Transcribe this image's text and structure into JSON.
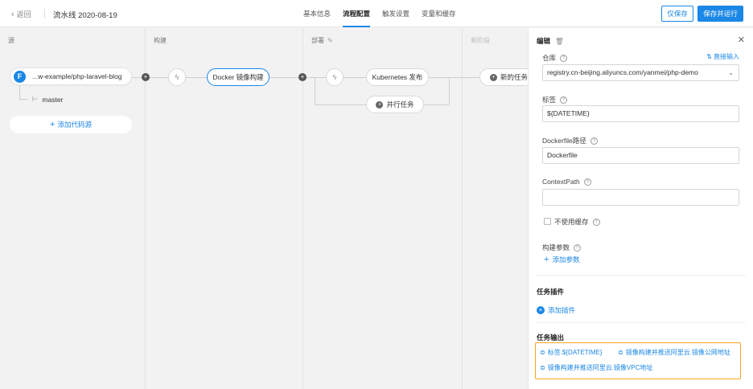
{
  "topbar": {
    "back_label": "返回",
    "pipeline_title": "流水线 2020-08-19",
    "tabs": [
      "基本信息",
      "流程配置",
      "触发设置",
      "变量和缓存"
    ],
    "save_only": "仅保存",
    "save_and_run": "保存并运行"
  },
  "stages": {
    "source_label": "源",
    "build_label": "构建",
    "deploy_label": "部署",
    "new_stage_label": "新阶段"
  },
  "source": {
    "repo": "...w-example/php-laravel-blog",
    "branch": "master",
    "add_source": "添加代码源"
  },
  "tasks": {
    "docker": "Docker 镜像构建",
    "k8s": "Kubernetes 发布",
    "parallel": "并行任务",
    "new_task": "新的任务"
  },
  "panel": {
    "title": "编辑",
    "repo_label": "仓库",
    "direct_input": "直接输入",
    "repo_value": "registry.cn-beijing.aliyuncs.com/yanmei/php-demo",
    "tag_label": "标签",
    "tag_value": "${DATETIME}",
    "dockerfile_label": "Dockerfile路径",
    "dockerfile_value": "Dockerfile",
    "context_label": "ContextPath",
    "context_value": "",
    "no_cache_label": "不使用缓存",
    "build_args_label": "构建参数",
    "add_args": "添加参数",
    "plugins_title": "任务插件",
    "add_plugin": "添加插件",
    "outputs_title": "任务输出",
    "outputs": [
      "标签.${DATETIME}",
      "镜像构建并推送阿里云.镜像公网地址",
      "镜像构建并推送阿里云.镜像VPC地址"
    ]
  },
  "colors": {
    "accent": "#1b87e6",
    "highlight": "#f5a623"
  }
}
